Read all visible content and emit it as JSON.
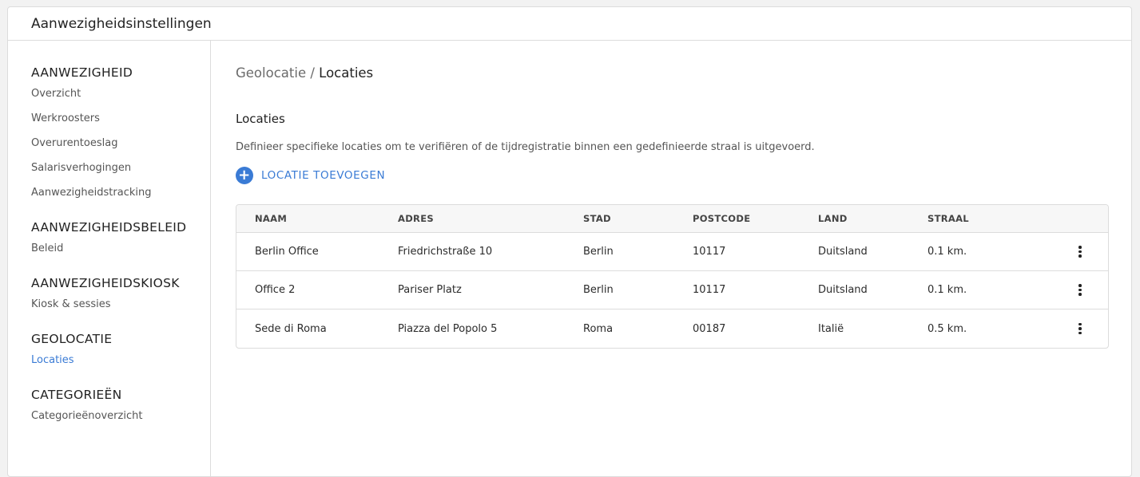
{
  "window": {
    "title": "Aanwezigheidsinstellingen"
  },
  "sidebar": {
    "sections": [
      {
        "title": "AANWEZIGHEID",
        "items": [
          "Overzicht",
          "Werkroosters",
          "Overurentoeslag",
          "Salarisverhogingen",
          "Aanwezigheidstracking"
        ]
      },
      {
        "title": "AANWEZIGHEIDSBELEID",
        "items": [
          "Beleid"
        ]
      },
      {
        "title": "AANWEZIGHEIDSKIOSK",
        "items": [
          "Kiosk & sessies"
        ]
      },
      {
        "title": "GEOLOCATIE",
        "items": [
          "Locaties"
        ]
      },
      {
        "title": "CATEGORIEËN",
        "items": [
          "Categorieënoverzicht"
        ]
      }
    ],
    "active_item": "Locaties"
  },
  "breadcrumb": {
    "parent": "Geolocatie",
    "separator": " / ",
    "current": "Locaties"
  },
  "content": {
    "heading": "Locaties",
    "description": "Definieer specifieke locaties om te verifiëren of de tijdregistratie binnen een gedefinieerde straal is uitgevoerd.",
    "add_button": {
      "label": "LOCATIE TOEVOEGEN",
      "icon": "plus-circle-icon"
    }
  },
  "table": {
    "headers": {
      "naam": "NAAM",
      "adres": "ADRES",
      "stad": "STAD",
      "postcode": "POSTCODE",
      "land": "LAND",
      "straal": "STRAAL"
    },
    "rows": [
      {
        "naam": "Berlin Office",
        "adres": "Friedrichstraße 10",
        "stad": "Berlin",
        "postcode": "10117",
        "land": "Duitsland",
        "straal": "0.1 km."
      },
      {
        "naam": "Office 2",
        "adres": "Pariser Platz",
        "stad": "Berlin",
        "postcode": "10117",
        "land": "Duitsland",
        "straal": "0.1 km."
      },
      {
        "naam": "Sede di Roma",
        "adres": "Piazza del Popolo 5",
        "stad": "Roma",
        "postcode": "00187",
        "land": "Italië",
        "straal": "0.5 km."
      }
    ]
  },
  "colors": {
    "accent": "#3a7bd5",
    "border": "#dcdcdc",
    "header_bg": "#f7f7f7"
  }
}
